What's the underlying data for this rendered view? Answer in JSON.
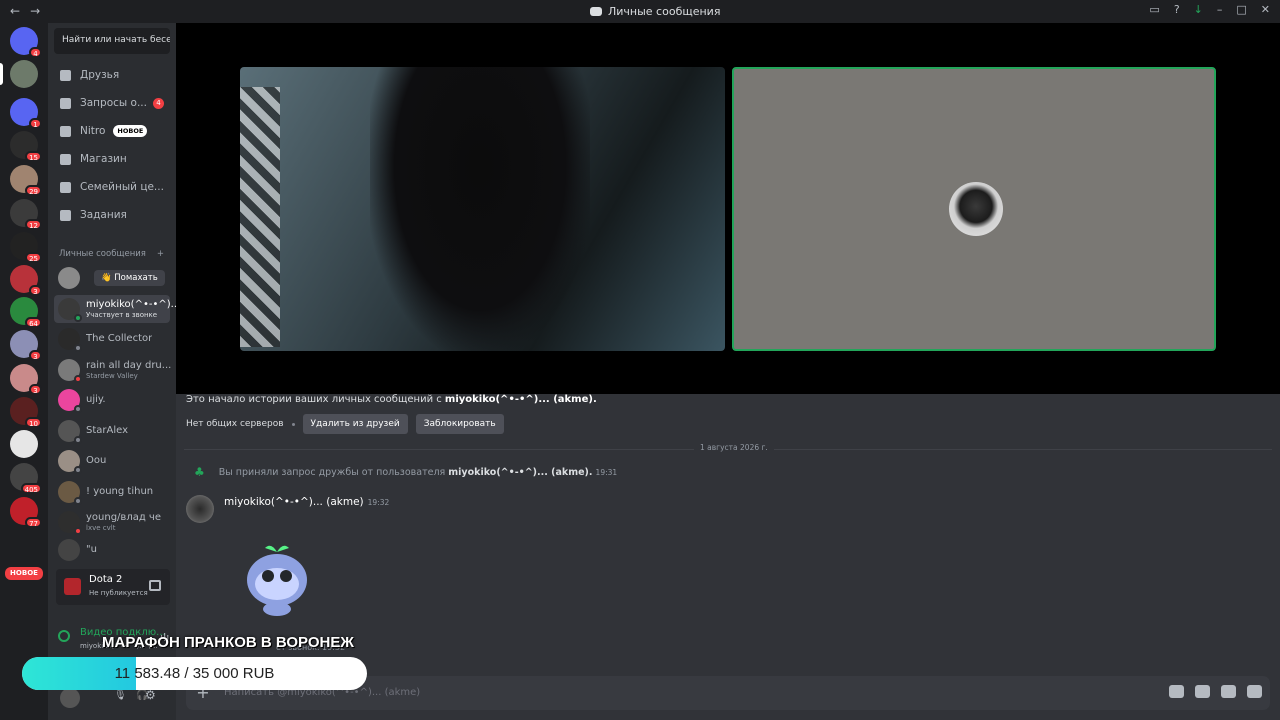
{
  "window": {
    "title": "Личные сообщения"
  },
  "search": {
    "placeholder": "Найти или начать бесе..."
  },
  "nav_items": [
    {
      "label": "Друзья",
      "icon": "friends-icon"
    },
    {
      "label": "Запросы о...",
      "icon": "mail-icon",
      "count": "4"
    },
    {
      "label": "Nitro",
      "icon": "nitro-icon",
      "badge": "НОВОЕ"
    },
    {
      "label": "Магазин",
      "icon": "shop-icon"
    },
    {
      "label": "Семейный це...",
      "icon": "family-icon"
    },
    {
      "label": "Задания",
      "icon": "quests-icon"
    }
  ],
  "dm_section": {
    "title": "Личные сообщения",
    "add": "+"
  },
  "wave_button": "👋 Помахать",
  "dms": [
    {
      "name": "miyokiko(^•-•^)...",
      "sub": "Участвует в звонке"
    },
    {
      "name": "The Collector",
      "sub": ""
    },
    {
      "name": "rain all day dru...",
      "sub": "Stardew Valley"
    },
    {
      "name": "ujiy.",
      "sub": ""
    },
    {
      "name": "StarAlex",
      "sub": ""
    },
    {
      "name": "Oou",
      "sub": ""
    },
    {
      "name": "! young tihun",
      "sub": ""
    },
    {
      "name": "young/влад че",
      "sub": "lxve cvlt"
    },
    {
      "name": "\"u",
      "sub": ""
    }
  ],
  "server_badges": [
    "4",
    "",
    "1",
    "15",
    "29",
    "12",
    "25",
    "3",
    "64",
    "3",
    "3",
    "10",
    "",
    "405",
    "77"
  ],
  "new_badge": "НОВОЕ",
  "game": {
    "name": "Dota 2",
    "status": "Не публикуется"
  },
  "voice": {
    "status": "Видео подклю...",
    "channel": "miyokiko(^•-•^)... (..."
  },
  "donation": {
    "title": "МАРАФОН ПРАНКОВ В ВОРОНЕЖ",
    "progress_text": "11 583.48 / 35 000 RUB",
    "progress_fraction": 0.331
  },
  "chat": {
    "intro_text": "Это начало истории ваших личных сообщений с ",
    "intro_name": "miyokiko(^•-•^)... (akme).",
    "no_servers": "Нет общих серверов",
    "remove_friend": "Удалить из друзей",
    "block": "Заблокировать",
    "date_divider": "1 августа 2026 г.",
    "system_text": "Вы приняли запрос дружбы от пользователя ",
    "system_name": "miyokiko(^•-•^)... (akme).",
    "system_time": "19:31",
    "author": "miyokiko(^•-•^)... (akme)",
    "message_time": "19:32",
    "call_text": "ет звонок. 19:32",
    "composer_placeholder": "Написать @miyokiko(^•-•^)... (akme)"
  },
  "colors": {
    "accent_green": "#23a55a",
    "badge_red": "#f23f43",
    "progress_fill": "#2ee6d6"
  }
}
